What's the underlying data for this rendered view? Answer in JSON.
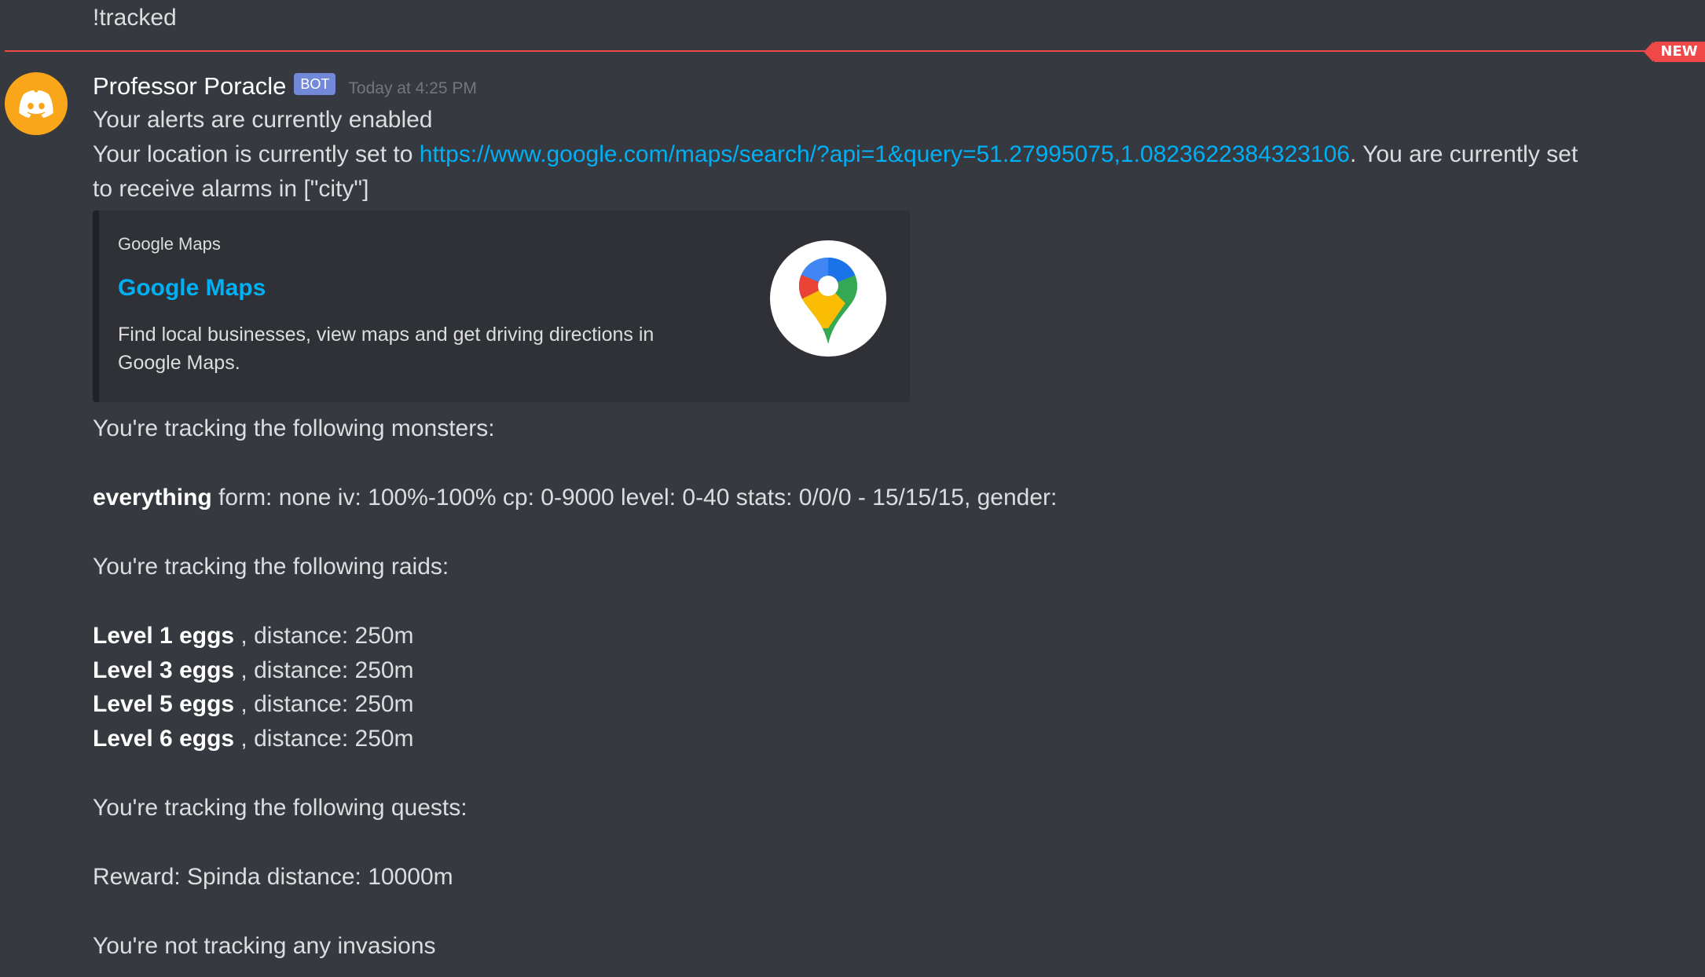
{
  "previous_message": {
    "text": "!tracked"
  },
  "divider": {
    "badge": "NEW"
  },
  "message": {
    "username": "Professor Poracle",
    "bot_tag": "BOT",
    "timestamp": "Today at 4:25 PM",
    "line1": "Your alerts are currently enabled",
    "location_prefix": "Your location is currently set to ",
    "location_link": "https://www.google.com/maps/search/?api=1&query=51.27995075,1.0823622384323106",
    "location_suffix": ". You are currently set",
    "location_line2": "to receive alarms in [\"city\"]",
    "embed": {
      "provider": "Google Maps",
      "title": "Google Maps",
      "description": "Find local businesses, view maps and get driving directions in Google Maps."
    },
    "monsters_header": "You're  tracking the following monsters:",
    "monster": {
      "name": "everything",
      "details": " form: none  iv: 100%-100% cp: 0-9000 level: 0-40 stats: 0/0/0 - 15/15/15, gender:"
    },
    "raids_header": "You're tracking the following raids:",
    "raids": [
      {
        "name": "Level 1 eggs",
        "details": " , distance: 250m"
      },
      {
        "name": "Level 3 eggs",
        "details": " , distance: 250m"
      },
      {
        "name": "Level 5 eggs",
        "details": " , distance: 250m"
      },
      {
        "name": "Level 6 eggs",
        "details": " , distance: 250m"
      }
    ],
    "quests_header": "You're tracking the following quests:",
    "quest": "Reward: Spinda distance: 10000m",
    "invasions": "You're not tracking any invasions"
  },
  "colors": {
    "background": "#36393f",
    "text": "#dcddde",
    "link": "#00b0f4",
    "bot_tag": "#7289da",
    "new_divider": "#f04747",
    "avatar": "#faa61a",
    "embed_bg": "#2f3136"
  },
  "icons": {
    "avatar": "discord-logo-icon",
    "embed_thumbnail": "google-maps-pin-icon"
  }
}
